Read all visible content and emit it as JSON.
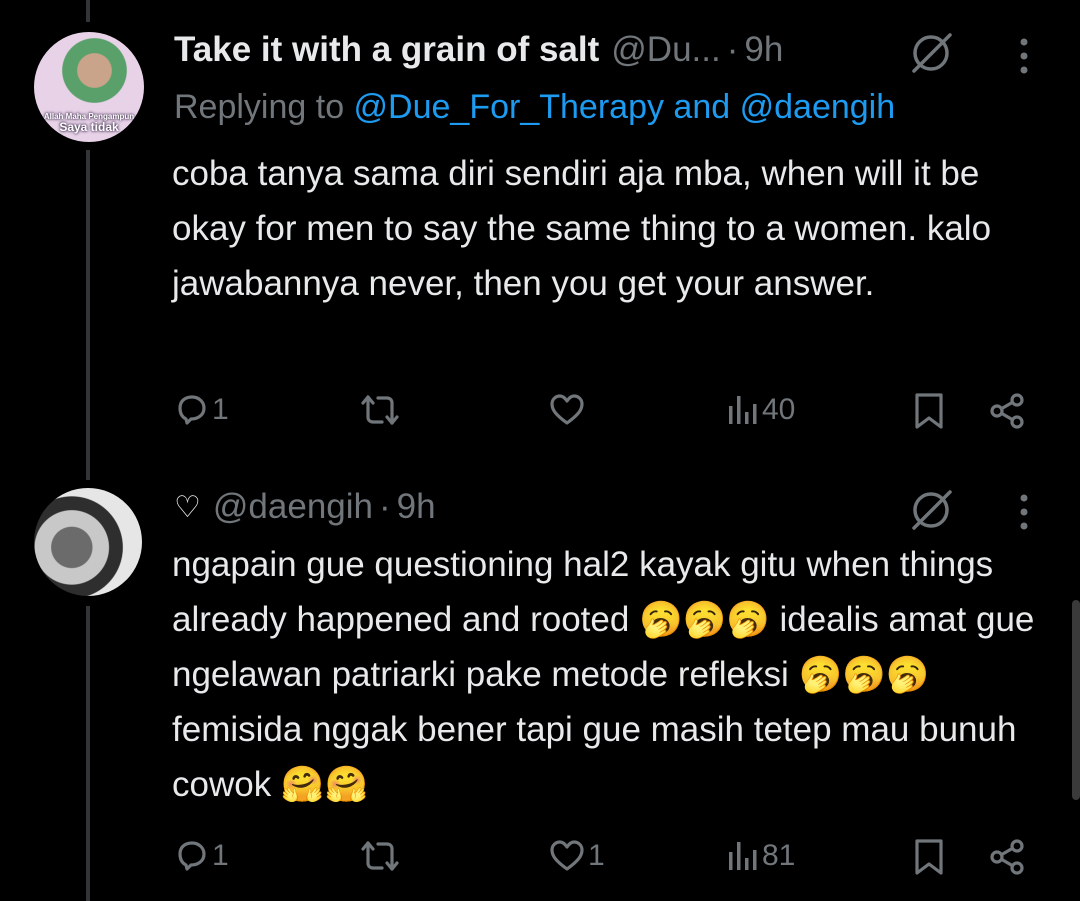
{
  "tweets": [
    {
      "name": "Take it with a grain of salt",
      "handle": "@Du...",
      "separator": "·",
      "time": "9h",
      "reply_prefix": "Replying to ",
      "reply_user1": "@Due_For_Therapy",
      "reply_and": " and ",
      "reply_user2": "@daengih",
      "avatar_caption_line1": "Allah Maha Pengampun",
      "avatar_caption_line2": "Saya tidak",
      "text": "coba tanya sama diri sendiri aja mba, when will it be okay for men to say the same thing to a women. kalo jawabannya never, then you get your answer.",
      "stats": {
        "replies": "1",
        "reposts": "",
        "likes": "",
        "views": "40"
      }
    },
    {
      "name_prefix": "♡",
      "handle": "@daengih",
      "separator": "·",
      "time": "9h",
      "text": "ngapain gue questioning hal2 kayak gitu when things already happened and rooted 🥱🥱🥱 idealis amat gue ngelawan patriarki pake metode refleksi 🥱🥱🥱 femisida nggak bener tapi gue masih tetep mau bunuh cowok 🤗🤗",
      "stats": {
        "replies": "1",
        "reposts": "",
        "likes": "1",
        "views": "81"
      }
    }
  ],
  "icons": [
    "grok-icon",
    "more-icon",
    "reply-icon",
    "repost-icon",
    "like-icon",
    "views-icon",
    "bookmark-icon",
    "share-icon"
  ],
  "colors": {
    "background": "#000000",
    "text": "#e7e9ea",
    "muted": "#71767b",
    "link": "#1d9bf0",
    "thread_line": "#333639"
  }
}
